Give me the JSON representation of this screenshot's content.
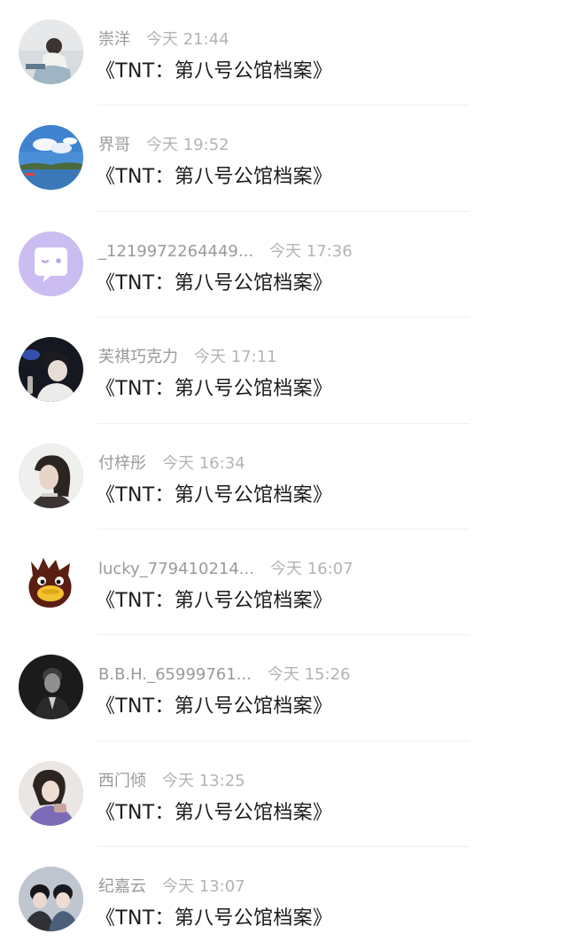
{
  "comments": [
    {
      "username": "崇洋",
      "time": "今天 21:44",
      "text": "《TNT：第八号公馆档案》",
      "avatar_icon": "person-sitting-avatar"
    },
    {
      "username": "界哥",
      "time": "今天 19:52",
      "text": "《TNT：第八号公馆档案》",
      "avatar_icon": "sky-lake-avatar"
    },
    {
      "username": "_1219972264449...",
      "time": "今天 17:36",
      "text": "《TNT：第八号公馆档案》",
      "avatar_icon": "default-chat-bubble-avatar"
    },
    {
      "username": "芙祺巧克力",
      "time": "今天 17:11",
      "text": "《TNT：第八号公馆档案》",
      "avatar_icon": "concert-person-avatar"
    },
    {
      "username": "付梓彤",
      "time": "今天 16:34",
      "text": "《TNT：第八号公馆档案》",
      "avatar_icon": "girl-profile-avatar"
    },
    {
      "username": "lucky_779410214...",
      "time": "今天 16:07",
      "text": "《TNT：第八号公馆档案》",
      "avatar_icon": "cartoon-duck-avatar"
    },
    {
      "username": "B.B.H._65999761...",
      "time": "今天 15:26",
      "text": "《TNT：第八号公馆档案》",
      "avatar_icon": "black-white-portrait-avatar"
    },
    {
      "username": "西门倾",
      "time": "今天 13:25",
      "text": "《TNT：第八号公馆档案》",
      "avatar_icon": "woman-purple-avatar"
    },
    {
      "username": "纪嘉云",
      "time": "今天 13:07",
      "text": "《TNT：第八号公馆档案》",
      "avatar_icon": "two-people-avatar"
    }
  ]
}
